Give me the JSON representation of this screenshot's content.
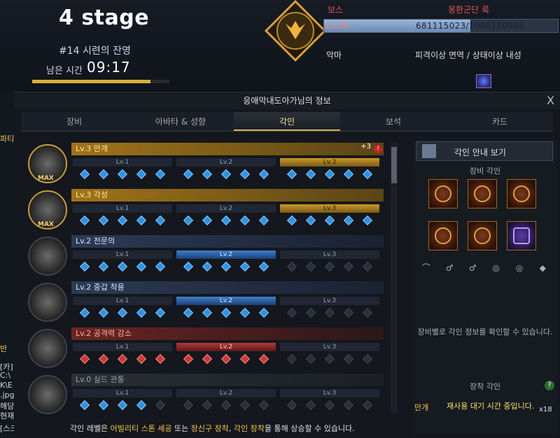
{
  "hud": {
    "stage": "4 stage",
    "trial": "#14 시련의 잔영",
    "remaining_label": "남은 시간",
    "remaining_time": "09:17",
    "timer_progress": 0.86
  },
  "boss": {
    "label": "보스",
    "name": "몽환군단 룩",
    "level": "Lv.59",
    "hp_text": "681115023/1086180066",
    "hp_fraction": 0.627,
    "type": "악마",
    "resist": "피격이상 면역 / 상태이상 내성"
  },
  "window": {
    "title": "응애막내도아가님의 정보",
    "close": "X",
    "tabs": [
      "장비",
      "아바타 & 성향",
      "각인",
      "보석",
      "카드"
    ],
    "active_tab": 2
  },
  "engravings": [
    {
      "label": "Lv.3 만개",
      "style": "gold",
      "level": 3,
      "max": true,
      "plus": "+3",
      "warn": "!",
      "dots": "b"
    },
    {
      "label": "Lv.3 각성",
      "style": "gold",
      "level": 3,
      "max": true,
      "dots": "b"
    },
    {
      "label": "Lv.2 전문의",
      "style": "blue",
      "level": 2,
      "dots": "b"
    },
    {
      "label": "Lv.2 중갑 착용",
      "style": "blue",
      "level": 2,
      "dots": "b"
    },
    {
      "label": "Lv.2 공격력 감소",
      "style": "red",
      "level": 2,
      "dots": "r"
    },
    {
      "label": "Lv.0 실드 관통",
      "style": "gray",
      "level": 0,
      "dots": "b"
    }
  ],
  "segments": [
    "Lv.1",
    "Lv.2",
    "Lv.3"
  ],
  "max_tag": "MAX",
  "footer": {
    "p1": "각인 레벨은 ",
    "h1": "어빌리티 스톤 세공",
    "p2": " 또는 ",
    "h2": "장신구 장착",
    "p3": ", ",
    "h3": "각인 장착",
    "p4": "을 통해 상승할 수 있습니다."
  },
  "right": {
    "guide": "각인 안내 보기",
    "equip_title": "장비 각인",
    "equip_desc": "장비별로 각인 정보를 확인할 수 있습니다.",
    "mount_title": "장착 각인",
    "mount_help": "?",
    "mount_full": "만개",
    "mount_cool": "재사용 대기 시간 중입니다.",
    "mount_count": "x18"
  },
  "background_text": {
    "party": "파티",
    "chat1": "[카]",
    "chat2": "C:\\",
    "chat3": "K\\E",
    "chat4": ".jpg",
    "chat5": "해당",
    "chat6": "현재",
    "chat7": "[스크",
    "vanish": "반"
  },
  "colors": {
    "gold": "#d7b24c",
    "boss_red": "#e05555",
    "hp_blue": "#8aa3cc"
  }
}
